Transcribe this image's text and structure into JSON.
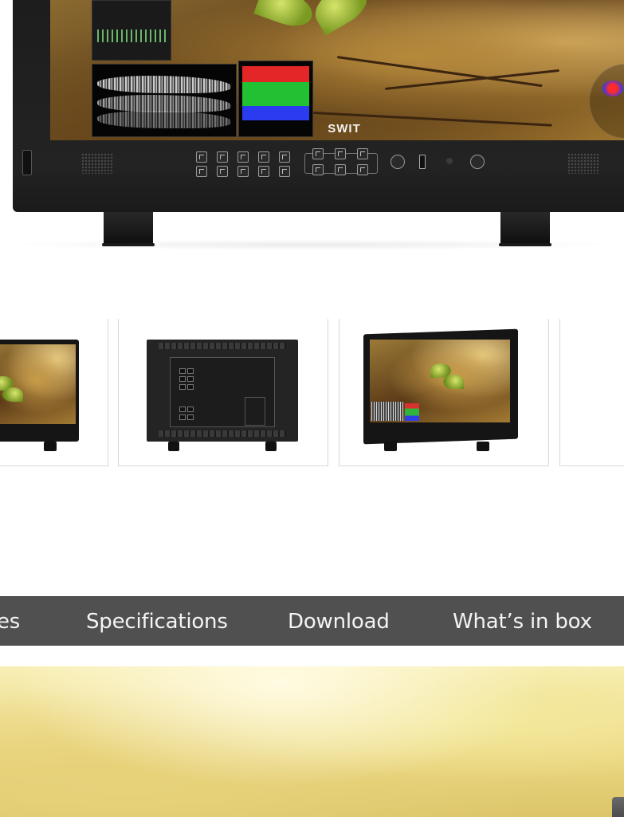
{
  "hero": {
    "brand_logo": "SWIT"
  },
  "gallery": {
    "thumbnails": [
      {
        "view": "front-left angle"
      },
      {
        "view": "rear"
      },
      {
        "view": "front-right angle"
      },
      {
        "view": "partial"
      }
    ]
  },
  "tabs": [
    {
      "label": "es"
    },
    {
      "label": "Specifications"
    },
    {
      "label": "Download"
    },
    {
      "label": "What’s in box"
    }
  ],
  "colors": {
    "tab_bar_bg": "#505050",
    "tab_text": "#f4f4f4",
    "monitor_body": "#1c1c1c",
    "thumb_border": "#d8d8d8"
  }
}
